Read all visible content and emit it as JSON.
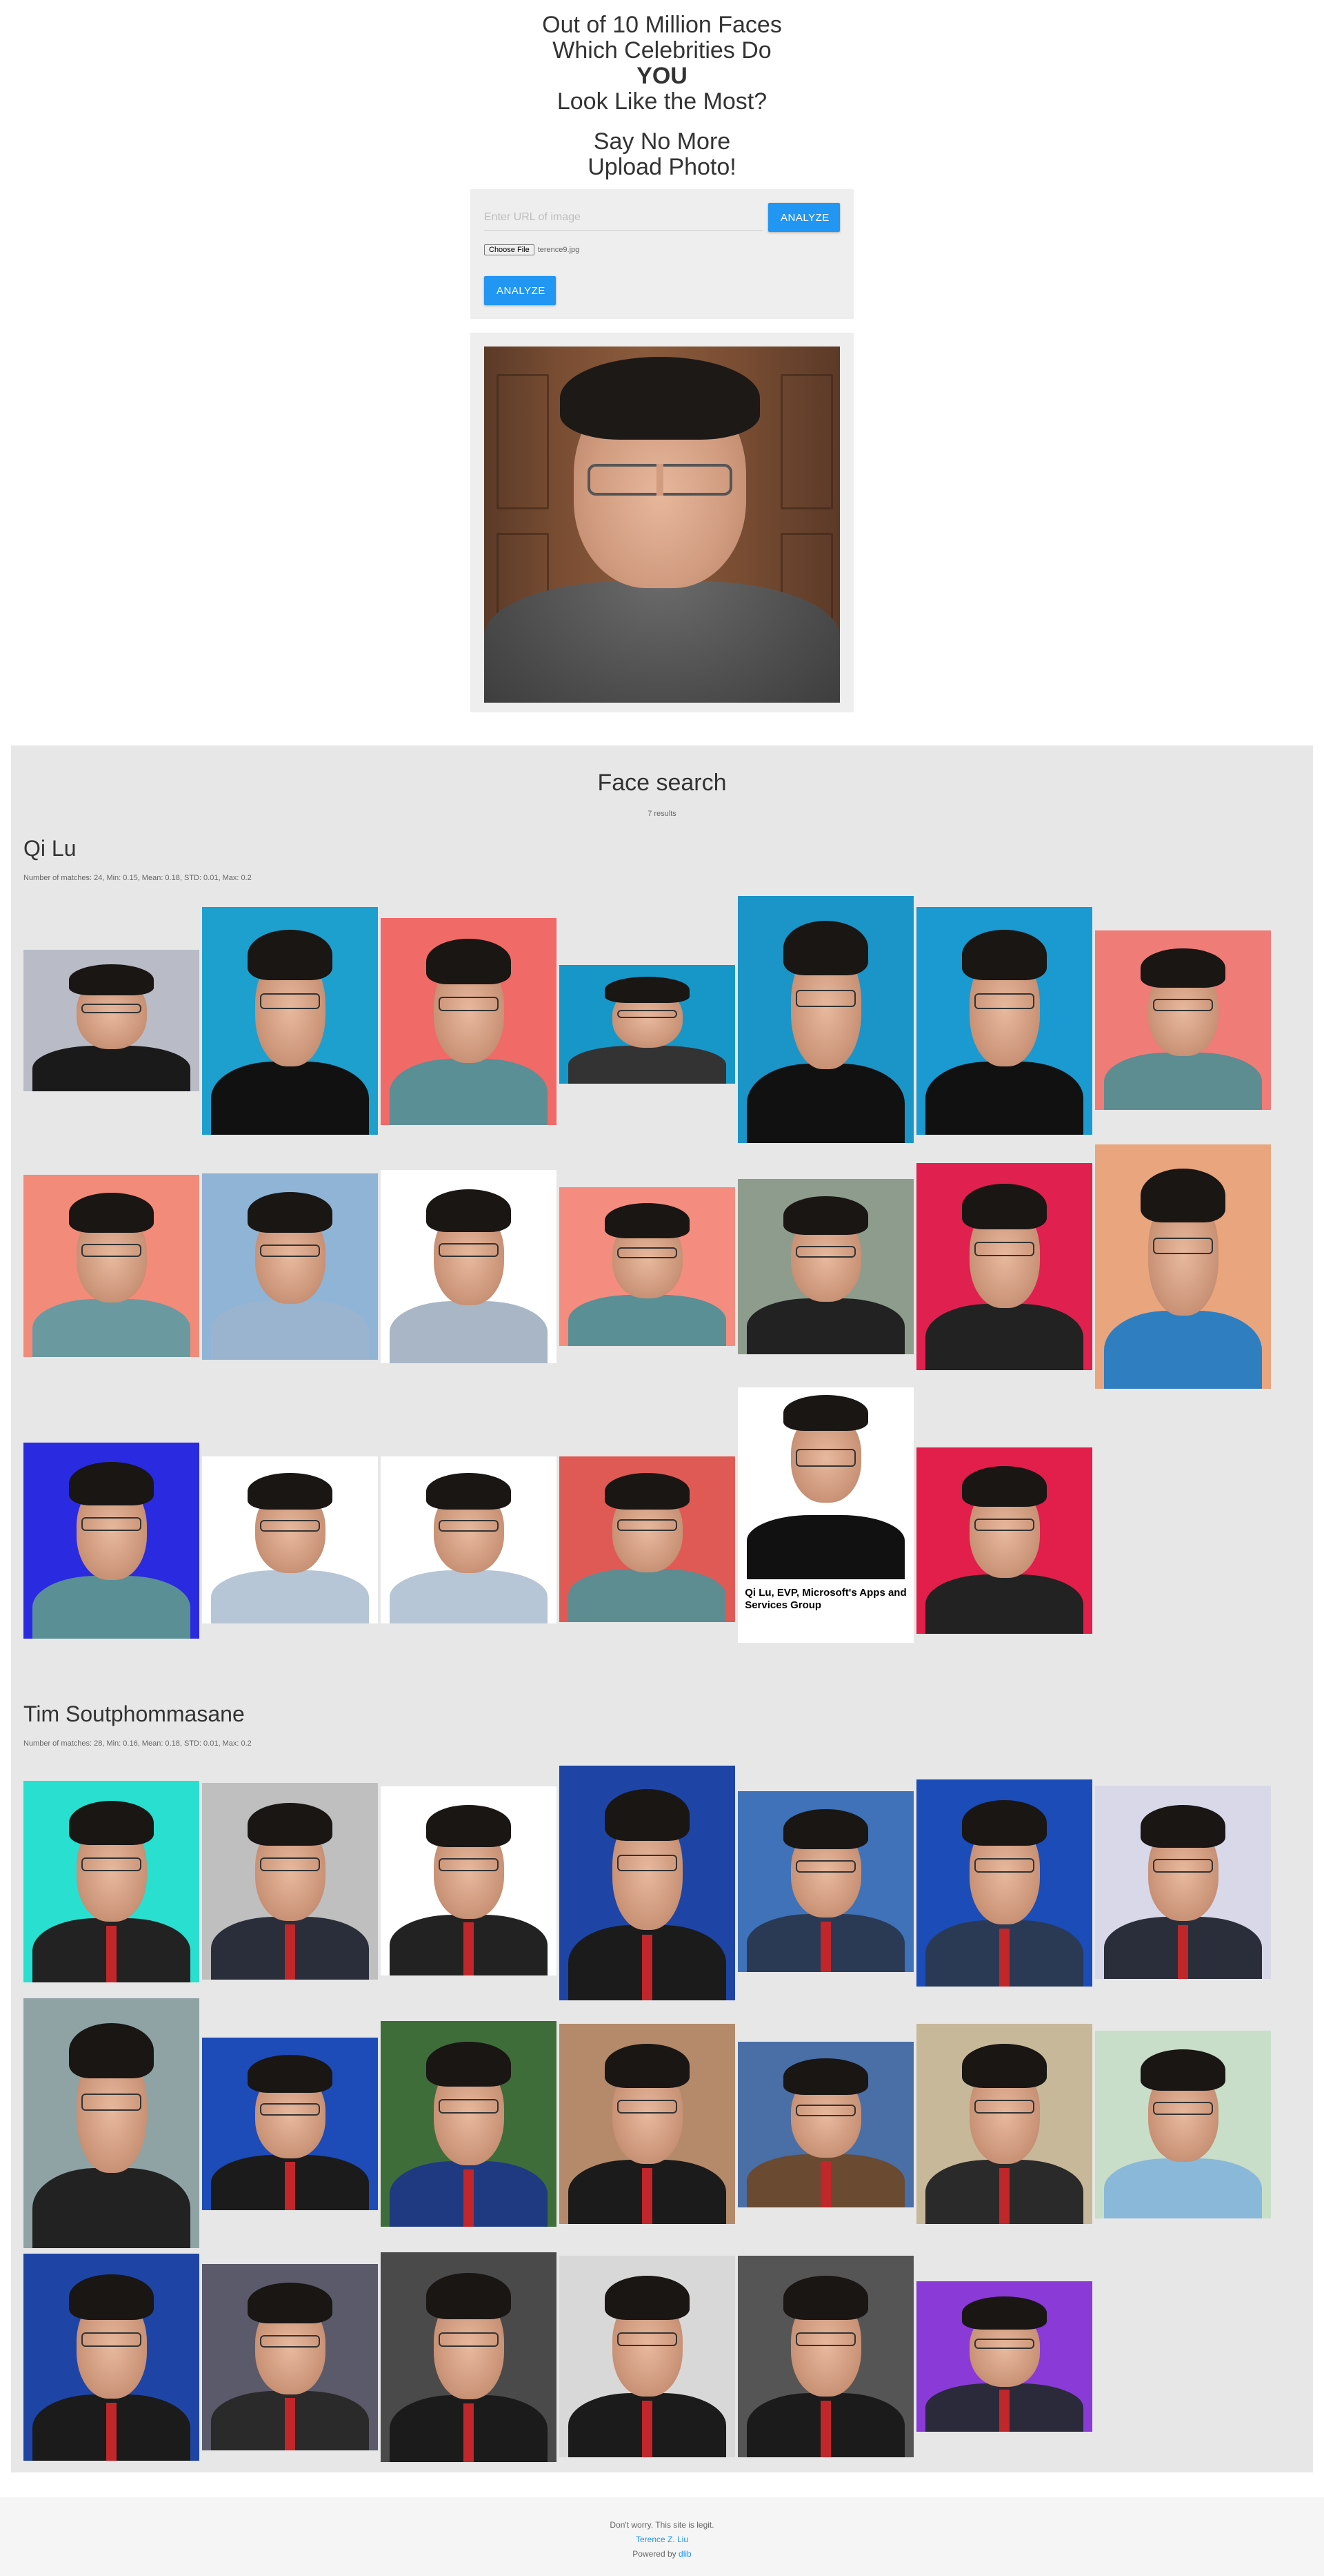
{
  "hero": {
    "line1": "Out of 10 Million Faces",
    "line2": "Which Celebrities Do",
    "line3": "YOU",
    "line4": "Look Like the Most?",
    "line5": "Say No More",
    "line6": "Upload Photo!"
  },
  "upload": {
    "url_placeholder": "Enter URL of image",
    "analyze_label": "ANALYZE",
    "choose_file_label": "Choose File",
    "file_name": "terence9.jpg",
    "analyze_label_2": "ANALYZE"
  },
  "results": {
    "title": "Face search",
    "count": "7 results",
    "people": [
      {
        "name": "Qi Lu",
        "stats": "Number of matches: 24, Min: 0.15, Mean: 0.18, STD: 0.01, Max: 0.2"
      },
      {
        "name": "Tim Soutphommasane",
        "stats": "Number of matches: 28, Min: 0.16, Mean: 0.18, STD: 0.01, Max: 0.2"
      }
    ],
    "caption": "Qi Lu, EVP, Microsoft's Apps and Services Group"
  },
  "footer": {
    "line1": "Don't worry. This site is legit.",
    "author": "Terence Z. Liu",
    "powered_prefix": "Powered by",
    "powered_link": "dlib"
  },
  "colors": {
    "accent": "#2196f3",
    "results_bg": "#e7e7e7"
  }
}
